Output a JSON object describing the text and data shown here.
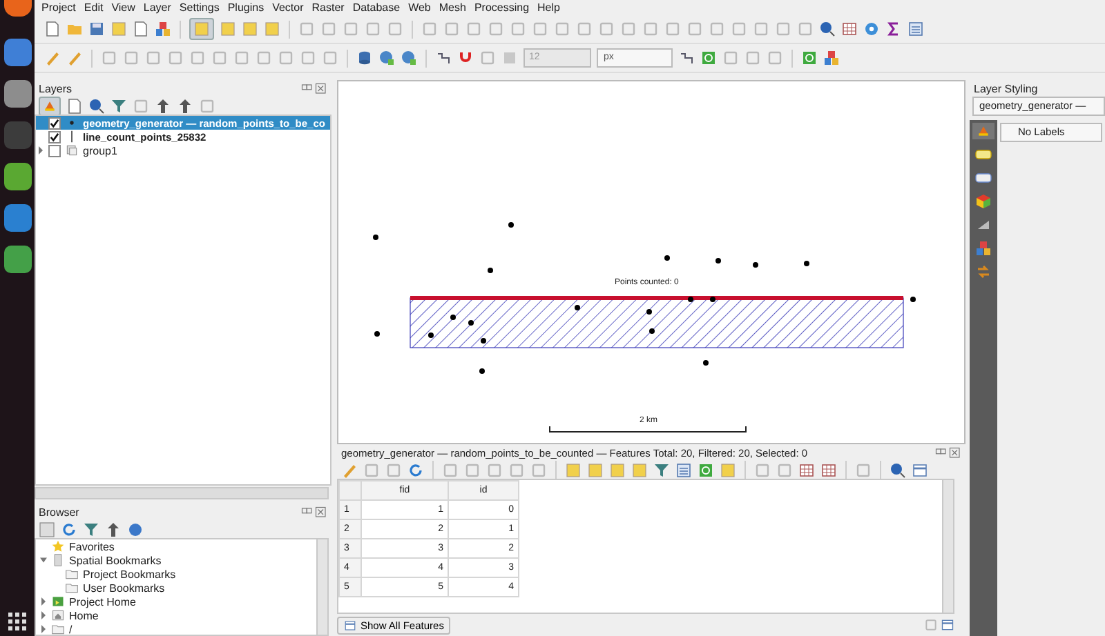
{
  "menu": [
    "Project",
    "Edit",
    "View",
    "Layer",
    "Settings",
    "Plugins",
    "Vector",
    "Raster",
    "Database",
    "Web",
    "Mesh",
    "Processing",
    "Help"
  ],
  "toolbar": {
    "size_value": "12",
    "unit": "px"
  },
  "layers_panel": {
    "title": "Layers",
    "items": [
      {
        "kind": "point_layer",
        "label": "geometry_generator — random_points_to_be_co",
        "checked": true,
        "selected": true
      },
      {
        "kind": "line_layer",
        "label": "line_count_points_25832",
        "checked": true,
        "selected": false
      },
      {
        "kind": "group",
        "label": "group1",
        "checked": false,
        "selected": false,
        "expanded": false
      }
    ]
  },
  "browser_panel": {
    "title": "Browser",
    "items": [
      {
        "kind": "favorites",
        "label": "Favorites"
      },
      {
        "kind": "bookmarks",
        "label": "Spatial Bookmarks",
        "expanded": true,
        "children": [
          {
            "kind": "folder",
            "label": "Project Bookmarks"
          },
          {
            "kind": "folder",
            "label": "User Bookmarks"
          }
        ]
      },
      {
        "kind": "project",
        "label": "Project Home",
        "expanded": false
      },
      {
        "kind": "home",
        "label": "Home",
        "expanded": false
      },
      {
        "kind": "folder",
        "label": "/",
        "expanded": false
      }
    ]
  },
  "map": {
    "label": "Points counted: 0",
    "scale_label": "2 km"
  },
  "attribute_table": {
    "title": "geometry_generator — random_points_to_be_counted — Features Total: 20, Filtered: 20, Selected: 0",
    "columns": [
      "fid",
      "id"
    ],
    "rows": [
      {
        "header": "1",
        "cells": [
          "1",
          "0"
        ]
      },
      {
        "header": "2",
        "cells": [
          "2",
          "1"
        ]
      },
      {
        "header": "3",
        "cells": [
          "3",
          "2"
        ]
      },
      {
        "header": "4",
        "cells": [
          "4",
          "3"
        ]
      },
      {
        "header": "5",
        "cells": [
          "5",
          "4"
        ]
      }
    ],
    "filter_button": "Show All Features"
  },
  "styling_panel": {
    "title": "Layer Styling",
    "layer": "geometry_generator —",
    "mode": "No Labels"
  }
}
